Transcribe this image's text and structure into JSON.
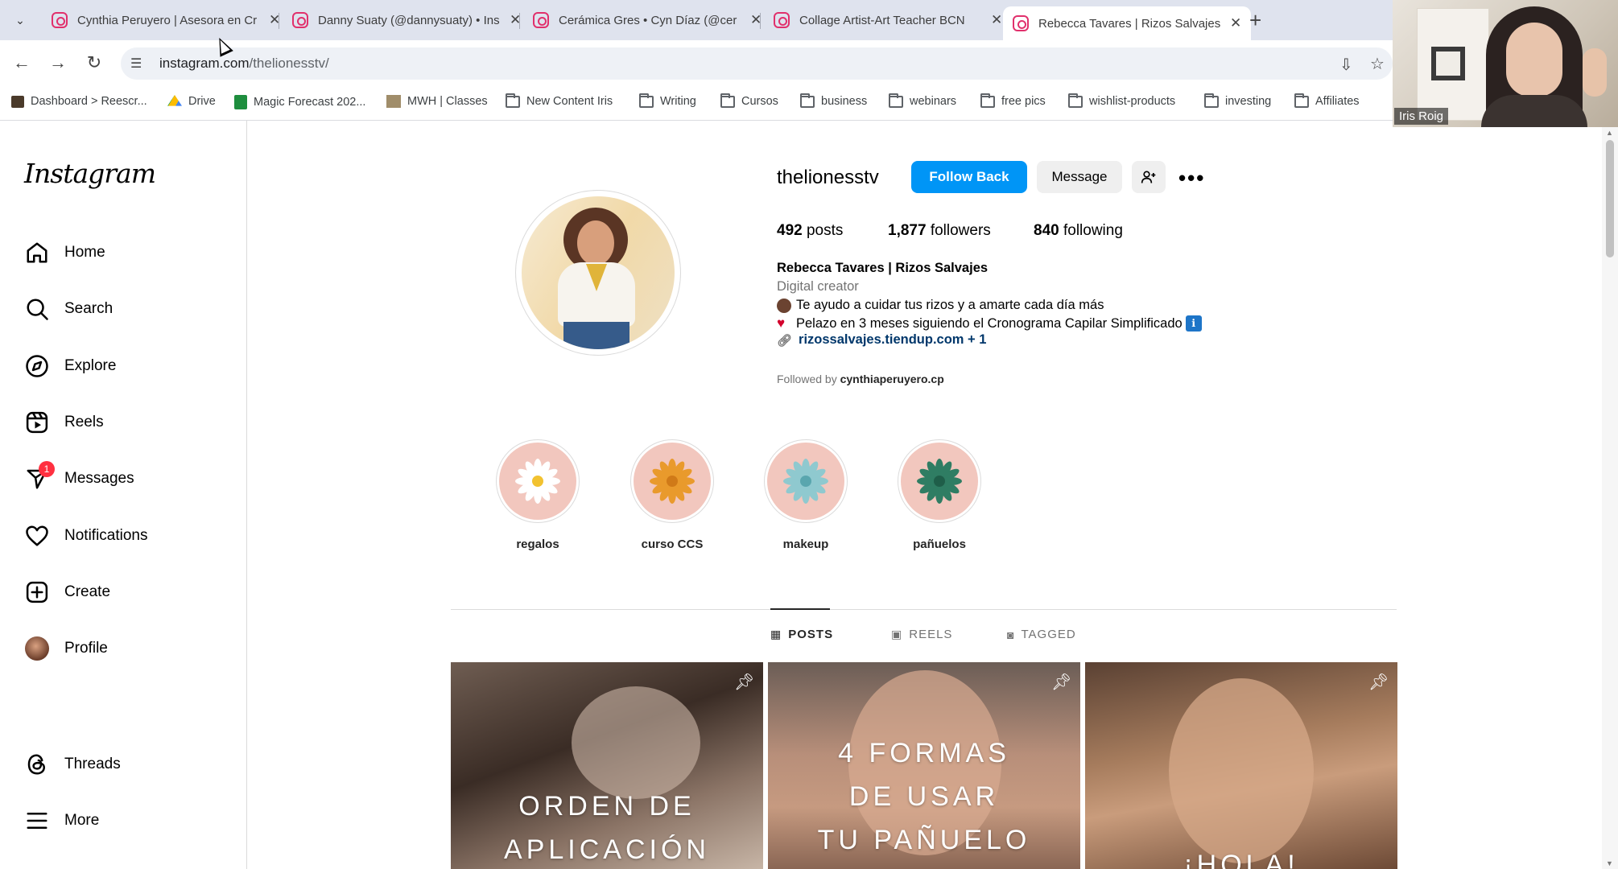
{
  "browser": {
    "tabs": [
      {
        "title": "Cynthia Peruyero | Asesora en Cr"
      },
      {
        "title": "Danny Suaty (@dannysuaty) • Ins"
      },
      {
        "title": "Cerámica Gres • Cyn Díaz (@cer"
      },
      {
        "title": "Collage Artist-Art Teacher BCN"
      },
      {
        "title": "Rebecca Tavares | Rizos Salvajes"
      }
    ],
    "url_host": "instagram.com",
    "url_path": "/thelionesstv/",
    "bookmarks": [
      {
        "label": "Dashboard > Reescr...",
        "icon": "page-icon"
      },
      {
        "label": "Drive",
        "icon": "drive-icon"
      },
      {
        "label": "Magic Forecast 202...",
        "icon": "sheets-icon"
      },
      {
        "label": "MWH | Classes",
        "icon": "page-icon"
      },
      {
        "label": "New Content Iris",
        "icon": "folder-icon"
      },
      {
        "label": "Writing",
        "icon": "folder-icon"
      },
      {
        "label": "Cursos",
        "icon": "folder-icon"
      },
      {
        "label": "business",
        "icon": "folder-icon"
      },
      {
        "label": "webinars",
        "icon": "folder-icon"
      },
      {
        "label": "free pics",
        "icon": "folder-icon"
      },
      {
        "label": "wishlist-products",
        "icon": "folder-icon"
      },
      {
        "label": "investing",
        "icon": "folder-icon"
      },
      {
        "label": "Affiliates",
        "icon": "folder-icon"
      }
    ]
  },
  "video_overlay": {
    "participant_name": "Iris Roig"
  },
  "sidebar": {
    "logo": "Instagram",
    "items": [
      {
        "label": "Home",
        "icon": "home-icon"
      },
      {
        "label": "Search",
        "icon": "search-icon"
      },
      {
        "label": "Explore",
        "icon": "compass-icon"
      },
      {
        "label": "Reels",
        "icon": "reels-icon"
      },
      {
        "label": "Messages",
        "icon": "messenger-icon",
        "badge": "1"
      },
      {
        "label": "Notifications",
        "icon": "heart-icon"
      },
      {
        "label": "Create",
        "icon": "plus-square-icon"
      },
      {
        "label": "Profile",
        "icon": "avatar"
      },
      {
        "label": "Threads",
        "icon": "threads-icon"
      },
      {
        "label": "More",
        "icon": "menu-icon"
      }
    ]
  },
  "profile": {
    "username": "thelionesstv",
    "follow_label": "Follow Back",
    "message_label": "Message",
    "stats": {
      "posts_count": "492",
      "posts_label": "posts",
      "followers_count": "1,877",
      "followers_label": "followers",
      "following_count": "840",
      "following_label": "following"
    },
    "full_name": "Rebecca Tavares | Rizos Salvajes",
    "category": "Digital creator",
    "bio_line_1": "Te ayudo a cuidar tus rizos y a amarte cada día más",
    "bio_line_2": "Pelazo en 3 meses siguiendo el Cronograma Capilar Simplificado",
    "bio_line_2_badge": "ℹ",
    "link": "rizossalvajes.tiendup.com + 1",
    "followed_by_prefix": "Followed by ",
    "followed_by_user": "cynthiaperuyero.cp"
  },
  "highlights": [
    {
      "label": "regalos",
      "flower_color": "#ffffff",
      "center_color": "#f2c230"
    },
    {
      "label": "curso CCS",
      "flower_color": "#e99a2c",
      "center_color": "#d07a18"
    },
    {
      "label": "makeup",
      "flower_color": "#8fc9cf",
      "center_color": "#5aa6ae"
    },
    {
      "label": "pañuelos",
      "flower_color": "#2f7d63",
      "center_color": "#1f5e49"
    }
  ],
  "tabs": [
    {
      "label": "POSTS",
      "icon": "grid-icon",
      "active": true
    },
    {
      "label": "REELS",
      "icon": "reels-icon",
      "active": false
    },
    {
      "label": "TAGGED",
      "icon": "tagged-icon",
      "active": false
    }
  ],
  "posts": [
    {
      "line_1": "ORDEN DE",
      "line_2": "APLICACIÓN",
      "line_3": "",
      "pinned": true
    },
    {
      "line_1": "4 FORMAS",
      "line_2": "DE USAR",
      "line_3": "TU PAÑUELO",
      "pinned": true
    },
    {
      "line_1": "",
      "line_2": "",
      "line_3": "¡HOLA!",
      "pinned": true
    }
  ],
  "colors": {
    "accent": "#0095f6",
    "link": "#00376b",
    "badge": "#ff3040"
  }
}
